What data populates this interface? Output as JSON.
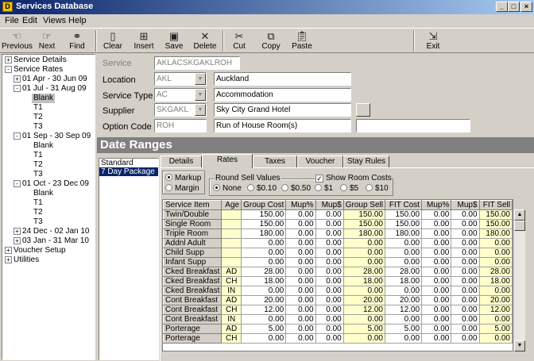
{
  "window": {
    "title": "Services Database",
    "minimize": "_",
    "maximize": "□",
    "close": "×"
  },
  "menu": [
    "File",
    "Edit",
    "Views",
    "Help"
  ],
  "toolbar": {
    "previous": "Previous",
    "next": "Next",
    "find": "Find",
    "clear": "Clear",
    "insert": "Insert",
    "save": "Save",
    "delete": "Delete",
    "cut": "Cut",
    "copy": "Copy",
    "paste": "Paste",
    "exit": "Exit"
  },
  "tree": [
    {
      "label": "Service Details",
      "exp": "+"
    },
    {
      "label": "Service Rates",
      "exp": "-"
    },
    {
      "label": "01 Apr - 30 Jun 09",
      "exp": "+"
    },
    {
      "label": "01 Jul - 31 Aug 09",
      "exp": "-"
    },
    {
      "label": "Blank"
    },
    {
      "label": "T1"
    },
    {
      "label": "T2"
    },
    {
      "label": "T3"
    },
    {
      "label": "01 Sep - 30 Sep 09",
      "exp": "-"
    },
    {
      "label": "Blank"
    },
    {
      "label": "T1"
    },
    {
      "label": "T2"
    },
    {
      "label": "T3"
    },
    {
      "label": "01 Oct - 23 Dec 09",
      "exp": "-"
    },
    {
      "label": "Blank"
    },
    {
      "label": "T1"
    },
    {
      "label": "T2"
    },
    {
      "label": "T3"
    },
    {
      "label": "24 Dec - 02 Jan 10",
      "exp": "+"
    },
    {
      "label": "03 Jan - 31 Mar 10",
      "exp": "+"
    },
    {
      "label": "Voucher Setup",
      "exp": "+"
    },
    {
      "label": "Utilities",
      "exp": "+"
    }
  ],
  "form": {
    "service_label": "Service",
    "service_code": "AKLACSKGAKLROH",
    "location_label": "Location",
    "location_code": "AKL",
    "location_name": "Auckland",
    "service_type_label": "Service Type",
    "service_type_code": "AC",
    "service_type_name": "Accommodation",
    "supplier_label": "Supplier",
    "supplier_code": "SKGAKL",
    "supplier_name": "Sky City Grand Hotel",
    "option_label": "Option Code",
    "option_code": "ROH",
    "option_name": "Run of House Room(s)",
    "option_extra": ""
  },
  "date_ranges": {
    "title": "Date Ranges",
    "list": [
      "Standard",
      "7 Day Package"
    ]
  },
  "tabs": [
    "Details",
    "Rates",
    "Taxes",
    "Voucher",
    "Stay Rules"
  ],
  "rates": {
    "markup": "Markup",
    "margin": "Margin",
    "round_label": "Round Sell Values",
    "round_options": [
      "None",
      "$0.10",
      "$0.50",
      "$1",
      "$5",
      "$10"
    ],
    "show_room_costs": "Show Room Costs"
  },
  "grid": {
    "headers": [
      "Service Item",
      "Age",
      "Group Cost",
      "Mup%",
      "Mup$",
      "Group Sell",
      "FIT Cost",
      "Mup%",
      "Mup$",
      "FIT Sell"
    ],
    "rows": [
      [
        "Twin/Double",
        "",
        "150.00",
        "0.00",
        "0.00",
        "150.00",
        "150.00",
        "0.00",
        "0.00",
        "150.00"
      ],
      [
        "Single Room",
        "",
        "150.00",
        "0.00",
        "0.00",
        "150.00",
        "150.00",
        "0.00",
        "0.00",
        "150.00"
      ],
      [
        "Triple Room",
        "",
        "180.00",
        "0.00",
        "0.00",
        "180.00",
        "180.00",
        "0.00",
        "0.00",
        "180.00"
      ],
      [
        "Addnl Adult",
        "",
        "0.00",
        "0.00",
        "0.00",
        "0.00",
        "0.00",
        "0.00",
        "0.00",
        "0.00"
      ],
      [
        "Child Supp",
        "",
        "0.00",
        "0.00",
        "0.00",
        "0.00",
        "0.00",
        "0.00",
        "0.00",
        "0.00"
      ],
      [
        "Infant Supp",
        "",
        "0.00",
        "0.00",
        "0.00",
        "0.00",
        "0.00",
        "0.00",
        "0.00",
        "0.00"
      ],
      [
        "Cked Breakfast",
        "AD",
        "28.00",
        "0.00",
        "0.00",
        "28.00",
        "28.00",
        "0.00",
        "0.00",
        "28.00"
      ],
      [
        "Cked Breakfast",
        "CH",
        "18.00",
        "0.00",
        "0.00",
        "18.00",
        "18.00",
        "0.00",
        "0.00",
        "18.00"
      ],
      [
        "Cked Breakfast",
        "IN",
        "0.00",
        "0.00",
        "0.00",
        "0.00",
        "0.00",
        "0.00",
        "0.00",
        "0.00"
      ],
      [
        "Cont Breakfast",
        "AD",
        "20.00",
        "0.00",
        "0.00",
        "20.00",
        "20.00",
        "0.00",
        "0.00",
        "20.00"
      ],
      [
        "Cont Breakfast",
        "CH",
        "12.00",
        "0.00",
        "0.00",
        "12.00",
        "12.00",
        "0.00",
        "0.00",
        "12.00"
      ],
      [
        "Cont Breakfast",
        "IN",
        "0.00",
        "0.00",
        "0.00",
        "0.00",
        "0.00",
        "0.00",
        "0.00",
        "0.00"
      ],
      [
        "Porterage",
        "AD",
        "5.00",
        "0.00",
        "0.00",
        "5.00",
        "5.00",
        "0.00",
        "0.00",
        "5.00"
      ],
      [
        "Porterage",
        "CH",
        "0.00",
        "0.00",
        "0.00",
        "0.00",
        "0.00",
        "0.00",
        "0.00",
        "0.00"
      ]
    ]
  }
}
